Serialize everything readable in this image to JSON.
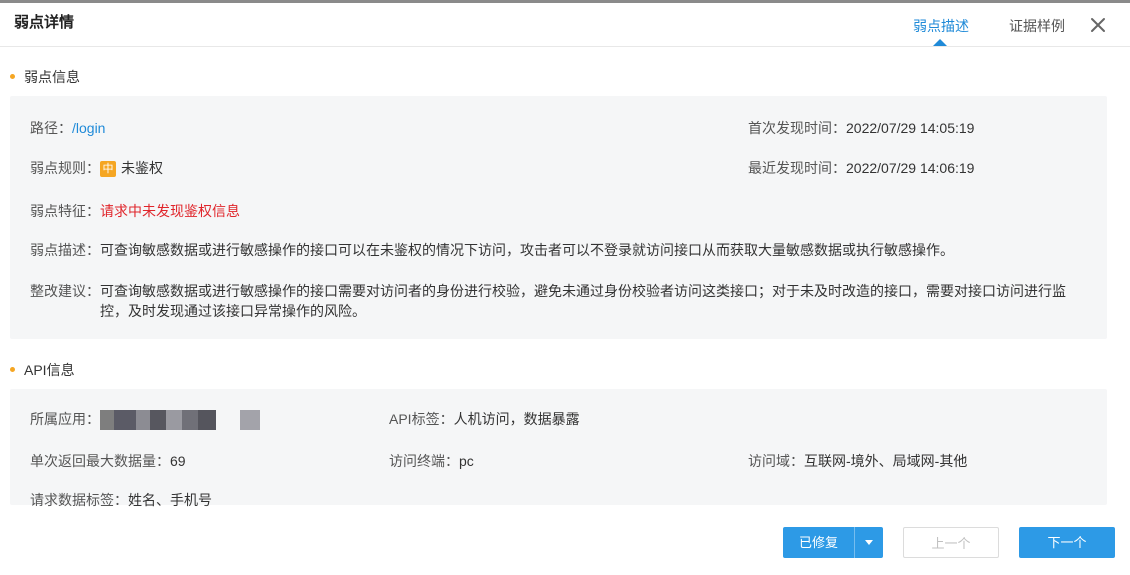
{
  "header": {
    "title": "弱点详情",
    "tabs": [
      {
        "label": "弱点描述",
        "active": true
      },
      {
        "label": "证据样例",
        "active": false
      }
    ],
    "close_icon": "close-icon"
  },
  "vuln_section": {
    "title": "弱点信息",
    "path_label": "路径：",
    "path_value": "/login",
    "first_found_label": "首次发现时间：",
    "first_found_value": "2022/07/29 14:05:19",
    "rule_label": "弱点规则：",
    "rule_level": "中",
    "rule_value": "未鉴权",
    "last_found_label": "最近发现时间：",
    "last_found_value": "2022/07/29 14:06:19",
    "feature_label": "弱点特征：",
    "feature_value": "请求中未发现鉴权信息",
    "desc_label": "弱点描述：",
    "desc_value": "可查询敏感数据或进行敏感操作的接口可以在未鉴权的情况下访问，攻击者可以不登录就访问接口从而获取大量敏感数据或执行敏感操作。",
    "advice_label": "整改建议：",
    "advice_line1": "可查询敏感数据或进行敏感操作的接口需要对访问者的身份进行校验，避免未通过身份校验者访问这类接口；对于未及时改造的接口，需要对接口访问进行监",
    "advice_line2": "控，及时发现通过该接口异常操作的风险。"
  },
  "api_section": {
    "title": "API信息",
    "app_label": "所属应用：",
    "tag_label": "API标签：",
    "tag_value": "人机访问，数据暴露",
    "max_return_label": "单次返回最大数据量：",
    "max_return_value": "69",
    "terminal_label": "访问终端：",
    "terminal_value": "pc",
    "domain_label": "访问域：",
    "domain_value": "互联网-境外、局域网-其他",
    "req_tag_label": "请求数据标签：",
    "req_tag_value": "姓名、手机号"
  },
  "footer": {
    "fixed_button": "已修复",
    "prev_button": "上一个",
    "next_button": "下一个"
  },
  "colors": {
    "accent": "#1f8ad8",
    "button": "#2d9ae6",
    "warning": "#f5a623",
    "danger": "#e0252b"
  }
}
